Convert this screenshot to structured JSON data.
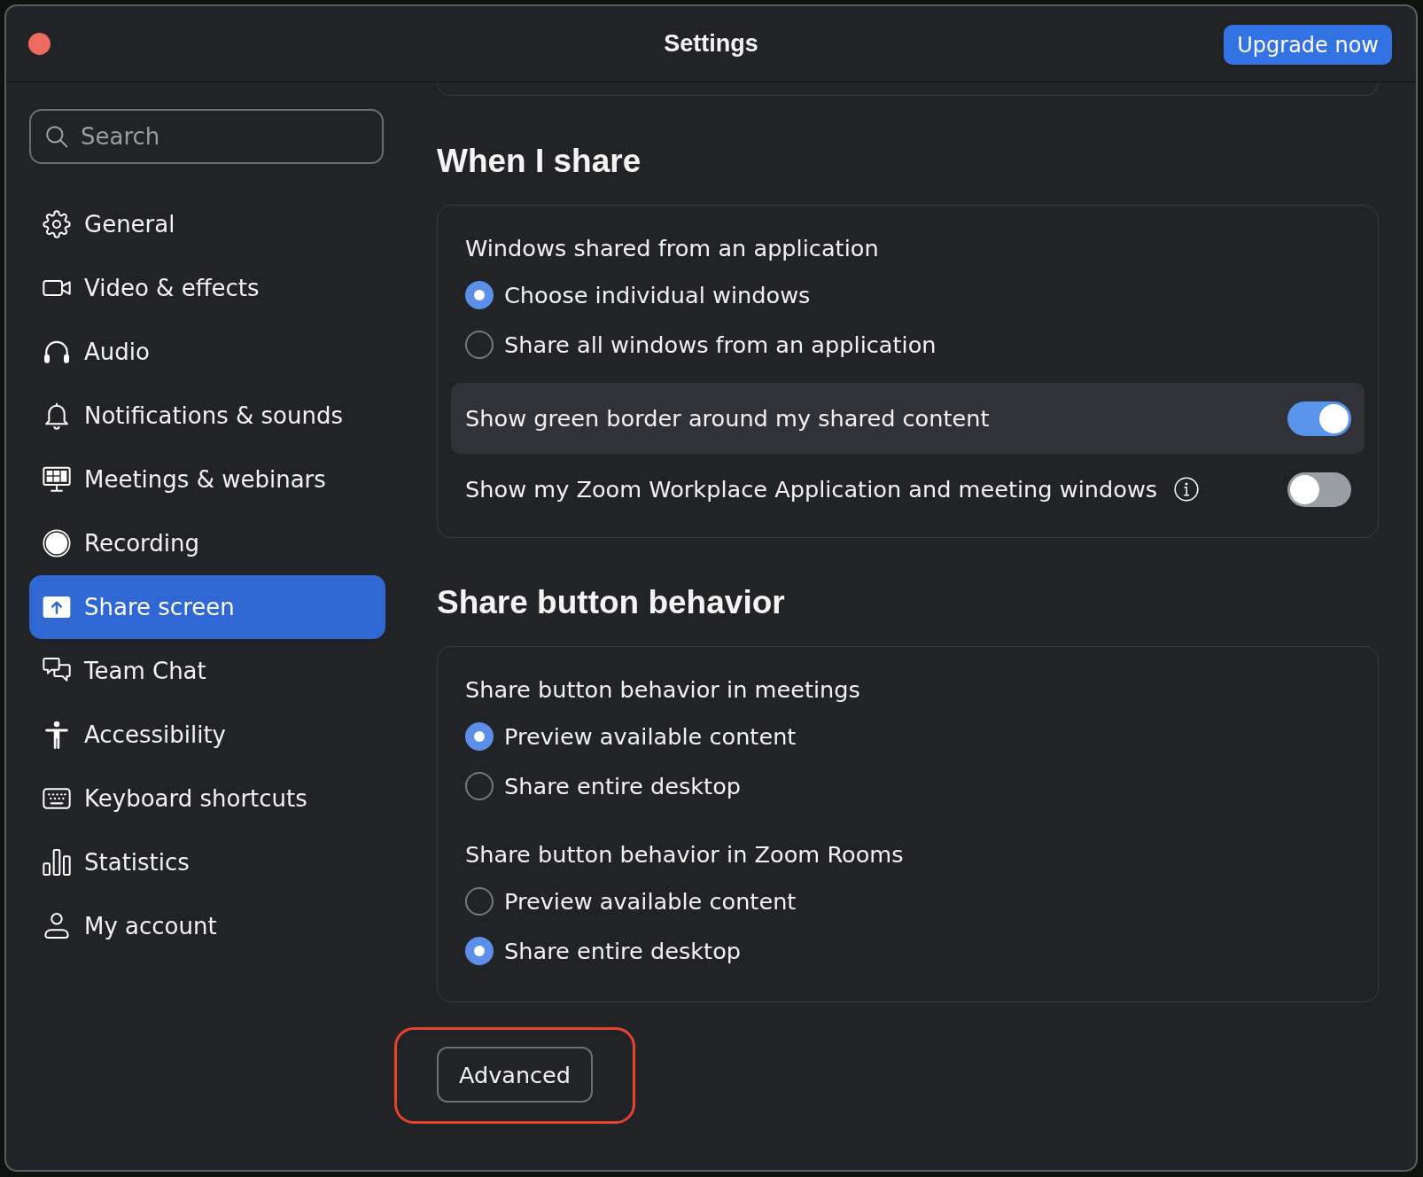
{
  "window": {
    "title": "Settings"
  },
  "upgrade_button": {
    "label": "Upgrade now"
  },
  "sidebar": {
    "search": {
      "placeholder": "Search"
    },
    "items": [
      {
        "label": "General",
        "selected": false
      },
      {
        "label": "Video & effects",
        "selected": false
      },
      {
        "label": "Audio",
        "selected": false
      },
      {
        "label": "Notifications & sounds",
        "selected": false
      },
      {
        "label": "Meetings & webinars",
        "selected": false
      },
      {
        "label": "Recording",
        "selected": false
      },
      {
        "label": "Share screen",
        "selected": true
      },
      {
        "label": "Team Chat",
        "selected": false
      },
      {
        "label": "Accessibility",
        "selected": false
      },
      {
        "label": "Keyboard shortcuts",
        "selected": false
      },
      {
        "label": "Statistics",
        "selected": false
      },
      {
        "label": "My account",
        "selected": false
      }
    ]
  },
  "content": {
    "sections": [
      {
        "heading": "When I share",
        "groups": [
          {
            "label": "Windows shared from an application",
            "options": [
              {
                "label": "Choose individual windows",
                "selected": true
              },
              {
                "label": "Share all windows from an application",
                "selected": false
              }
            ]
          }
        ],
        "toggles": [
          {
            "label": "Show green border around my shared content",
            "on": true,
            "highlighted": true,
            "info_icon": false
          },
          {
            "label": "Show my Zoom Workplace Application and meeting windows",
            "on": false,
            "highlighted": false,
            "info_icon": true
          }
        ]
      },
      {
        "heading": "Share button behavior",
        "groups": [
          {
            "label": "Share button behavior in meetings",
            "options": [
              {
                "label": "Preview available content",
                "selected": true
              },
              {
                "label": "Share entire desktop",
                "selected": false
              }
            ]
          },
          {
            "label": "Share button behavior in Zoom Rooms",
            "options": [
              {
                "label": "Preview available content",
                "selected": false
              },
              {
                "label": "Share entire desktop",
                "selected": true
              }
            ]
          }
        ]
      }
    ]
  },
  "advanced_button": {
    "label": "Advanced",
    "highlighted": true
  }
}
